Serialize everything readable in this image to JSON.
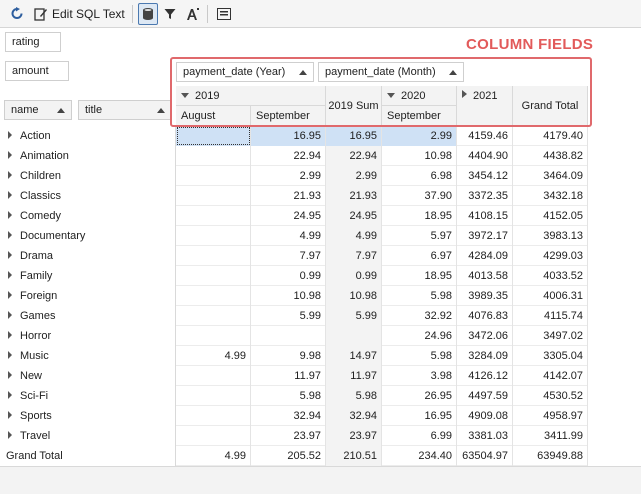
{
  "toolbar": {
    "edit_sql_label": "Edit SQL Text"
  },
  "filter_fields": {
    "rating": "rating",
    "amount": "amount"
  },
  "annotation": {
    "column_fields": "COLUMN FIELDS"
  },
  "column_fields": {
    "year_field": "payment_date (Year)",
    "month_field": "payment_date (Month)"
  },
  "row_fields": {
    "name": "name",
    "title": "title"
  },
  "column_headers": {
    "y2019": "2019",
    "august": "August",
    "september": "September",
    "sum2019": "2019 Sum",
    "y2020": "2020",
    "september2020": "September",
    "y2021": "2021",
    "grand_total": "Grand Total"
  },
  "rows": [
    {
      "name": "Action",
      "aug": "",
      "sep": "16.95",
      "sum": "16.95",
      "sep20": "2.99",
      "y21": "4159.46",
      "total": "4179.40"
    },
    {
      "name": "Animation",
      "aug": "",
      "sep": "22.94",
      "sum": "22.94",
      "sep20": "10.98",
      "y21": "4404.90",
      "total": "4438.82"
    },
    {
      "name": "Children",
      "aug": "",
      "sep": "2.99",
      "sum": "2.99",
      "sep20": "6.98",
      "y21": "3454.12",
      "total": "3464.09"
    },
    {
      "name": "Classics",
      "aug": "",
      "sep": "21.93",
      "sum": "21.93",
      "sep20": "37.90",
      "y21": "3372.35",
      "total": "3432.18"
    },
    {
      "name": "Comedy",
      "aug": "",
      "sep": "24.95",
      "sum": "24.95",
      "sep20": "18.95",
      "y21": "4108.15",
      "total": "4152.05"
    },
    {
      "name": "Documentary",
      "aug": "",
      "sep": "4.99",
      "sum": "4.99",
      "sep20": "5.97",
      "y21": "3972.17",
      "total": "3983.13"
    },
    {
      "name": "Drama",
      "aug": "",
      "sep": "7.97",
      "sum": "7.97",
      "sep20": "6.97",
      "y21": "4284.09",
      "total": "4299.03"
    },
    {
      "name": "Family",
      "aug": "",
      "sep": "0.99",
      "sum": "0.99",
      "sep20": "18.95",
      "y21": "4013.58",
      "total": "4033.52"
    },
    {
      "name": "Foreign",
      "aug": "",
      "sep": "10.98",
      "sum": "10.98",
      "sep20": "5.98",
      "y21": "3989.35",
      "total": "4006.31"
    },
    {
      "name": "Games",
      "aug": "",
      "sep": "5.99",
      "sum": "5.99",
      "sep20": "32.92",
      "y21": "4076.83",
      "total": "4115.74"
    },
    {
      "name": "Horror",
      "aug": "",
      "sep": "",
      "sum": "",
      "sep20": "24.96",
      "y21": "3472.06",
      "total": "3497.02"
    },
    {
      "name": "Music",
      "aug": "4.99",
      "sep": "9.98",
      "sum": "14.97",
      "sep20": "5.98",
      "y21": "3284.09",
      "total": "3305.04"
    },
    {
      "name": "New",
      "aug": "",
      "sep": "11.97",
      "sum": "11.97",
      "sep20": "3.98",
      "y21": "4126.12",
      "total": "4142.07"
    },
    {
      "name": "Sci-Fi",
      "aug": "",
      "sep": "5.98",
      "sum": "5.98",
      "sep20": "26.95",
      "y21": "4497.59",
      "total": "4530.52"
    },
    {
      "name": "Sports",
      "aug": "",
      "sep": "32.94",
      "sum": "32.94",
      "sep20": "16.95",
      "y21": "4909.08",
      "total": "4958.97"
    },
    {
      "name": "Travel",
      "aug": "",
      "sep": "23.97",
      "sum": "23.97",
      "sep20": "6.99",
      "y21": "3381.03",
      "total": "3411.99"
    }
  ],
  "grand_total_row": {
    "label": "Grand Total",
    "aug": "4.99",
    "sep": "205.52",
    "sum": "210.51",
    "sep20": "234.40",
    "y21": "63504.97",
    "total": "63949.88"
  },
  "colors": {
    "accent": "#e25a5a",
    "selection": "#cfe1f5"
  }
}
